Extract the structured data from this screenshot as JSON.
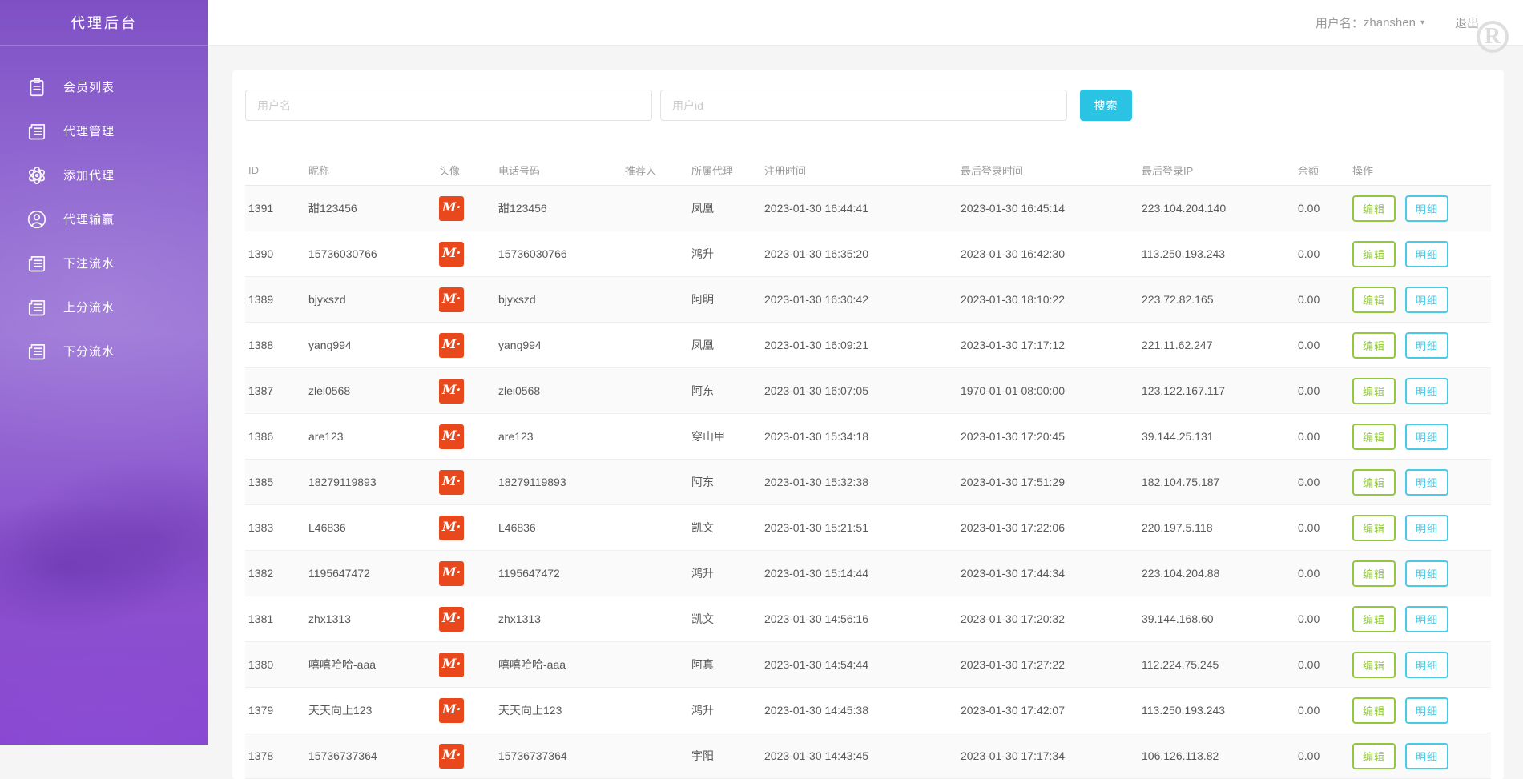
{
  "app": {
    "title": "代理后台"
  },
  "topbar": {
    "username_label": "用户名：",
    "username": "zhanshen",
    "caret": "▾",
    "logout": "退出",
    "watermark_letter": "R"
  },
  "sidebar": {
    "items": [
      {
        "name": "member-list",
        "icon": "clipboard",
        "label": "会员列表"
      },
      {
        "name": "agent-manage",
        "icon": "newspaper",
        "label": "代理管理"
      },
      {
        "name": "agent-add",
        "icon": "atom",
        "label": "添加代理"
      },
      {
        "name": "agent-winloss",
        "icon": "user-circle",
        "label": "代理输赢"
      },
      {
        "name": "bet-flow",
        "icon": "newspaper",
        "label": "下注流水"
      },
      {
        "name": "credit-flow",
        "icon": "newspaper",
        "label": "上分流水"
      },
      {
        "name": "debit-flow",
        "icon": "newspaper",
        "label": "下分流水"
      }
    ]
  },
  "search": {
    "username_placeholder": "用户名",
    "userid_placeholder": "用户id",
    "button_label": "搜索"
  },
  "table": {
    "columns": [
      "ID",
      "昵称",
      "头像",
      "电话号码",
      "推荐人",
      "所属代理",
      "注册时间",
      "最后登录时间",
      "最后登录IP",
      "余额",
      "操作"
    ],
    "avatar_glyph": "M·",
    "action_edit": "编辑",
    "action_detail": "明细",
    "rows": [
      {
        "id": "1391",
        "nickname": "甜123456",
        "phone": "甜123456",
        "referrer": "",
        "agent": "凤凰",
        "reg_time": "2023-01-30 16:44:41",
        "last_login": "2023-01-30 16:45:14",
        "ip": "223.104.204.140",
        "balance": "0.00"
      },
      {
        "id": "1390",
        "nickname": "15736030766",
        "phone": "15736030766",
        "referrer": "",
        "agent": "鸿升",
        "reg_time": "2023-01-30 16:35:20",
        "last_login": "2023-01-30 16:42:30",
        "ip": "113.250.193.243",
        "balance": "0.00"
      },
      {
        "id": "1389",
        "nickname": "bjyxszd",
        "phone": "bjyxszd",
        "referrer": "",
        "agent": "阿明",
        "reg_time": "2023-01-30 16:30:42",
        "last_login": "2023-01-30 18:10:22",
        "ip": "223.72.82.165",
        "balance": "0.00"
      },
      {
        "id": "1388",
        "nickname": "yang994",
        "phone": "yang994",
        "referrer": "",
        "agent": "凤凰",
        "reg_time": "2023-01-30 16:09:21",
        "last_login": "2023-01-30 17:17:12",
        "ip": "221.11.62.247",
        "balance": "0.00"
      },
      {
        "id": "1387",
        "nickname": "zlei0568",
        "phone": "zlei0568",
        "referrer": "",
        "agent": "阿东",
        "reg_time": "2023-01-30 16:07:05",
        "last_login": "1970-01-01 08:00:00",
        "ip": "123.122.167.117",
        "balance": "0.00"
      },
      {
        "id": "1386",
        "nickname": "are123",
        "phone": "are123",
        "referrer": "",
        "agent": "穿山甲",
        "reg_time": "2023-01-30 15:34:18",
        "last_login": "2023-01-30 17:20:45",
        "ip": "39.144.25.131",
        "balance": "0.00"
      },
      {
        "id": "1385",
        "nickname": "18279119893",
        "phone": "18279119893",
        "referrer": "",
        "agent": "阿东",
        "reg_time": "2023-01-30 15:32:38",
        "last_login": "2023-01-30 17:51:29",
        "ip": "182.104.75.187",
        "balance": "0.00"
      },
      {
        "id": "1383",
        "nickname": "L46836",
        "phone": "L46836",
        "referrer": "",
        "agent": "凯文",
        "reg_time": "2023-01-30 15:21:51",
        "last_login": "2023-01-30 17:22:06",
        "ip": "220.197.5.118",
        "balance": "0.00"
      },
      {
        "id": "1382",
        "nickname": "1195647472",
        "phone": "1195647472",
        "referrer": "",
        "agent": "鸿升",
        "reg_time": "2023-01-30 15:14:44",
        "last_login": "2023-01-30 17:44:34",
        "ip": "223.104.204.88",
        "balance": "0.00"
      },
      {
        "id": "1381",
        "nickname": "zhx1313",
        "phone": "zhx1313",
        "referrer": "",
        "agent": "凯文",
        "reg_time": "2023-01-30 14:56:16",
        "last_login": "2023-01-30 17:20:32",
        "ip": "39.144.168.60",
        "balance": "0.00"
      },
      {
        "id": "1380",
        "nickname": "嘻嘻哈哈-aaa",
        "phone": "嘻嘻哈哈-aaa",
        "referrer": "",
        "agent": "阿真",
        "reg_time": "2023-01-30 14:54:44",
        "last_login": "2023-01-30 17:27:22",
        "ip": "112.224.75.245",
        "balance": "0.00"
      },
      {
        "id": "1379",
        "nickname": "天天向上123",
        "phone": "天天向上123",
        "referrer": "",
        "agent": "鸿升",
        "reg_time": "2023-01-30 14:45:38",
        "last_login": "2023-01-30 17:42:07",
        "ip": "113.250.193.243",
        "balance": "0.00"
      },
      {
        "id": "1378",
        "nickname": "15736737364",
        "phone": "15736737364",
        "referrer": "",
        "agent": "宇阳",
        "reg_time": "2023-01-30 14:43:45",
        "last_login": "2023-01-30 17:17:34",
        "ip": "106.126.113.82",
        "balance": "0.00"
      }
    ]
  },
  "colors": {
    "sidebar_purple": "#8d5fcf",
    "accent_cyan": "#2bc3e4",
    "edit_green": "#93c73d",
    "detail_cyan": "#47cbe8",
    "avatar_orange": "#e8481c"
  }
}
